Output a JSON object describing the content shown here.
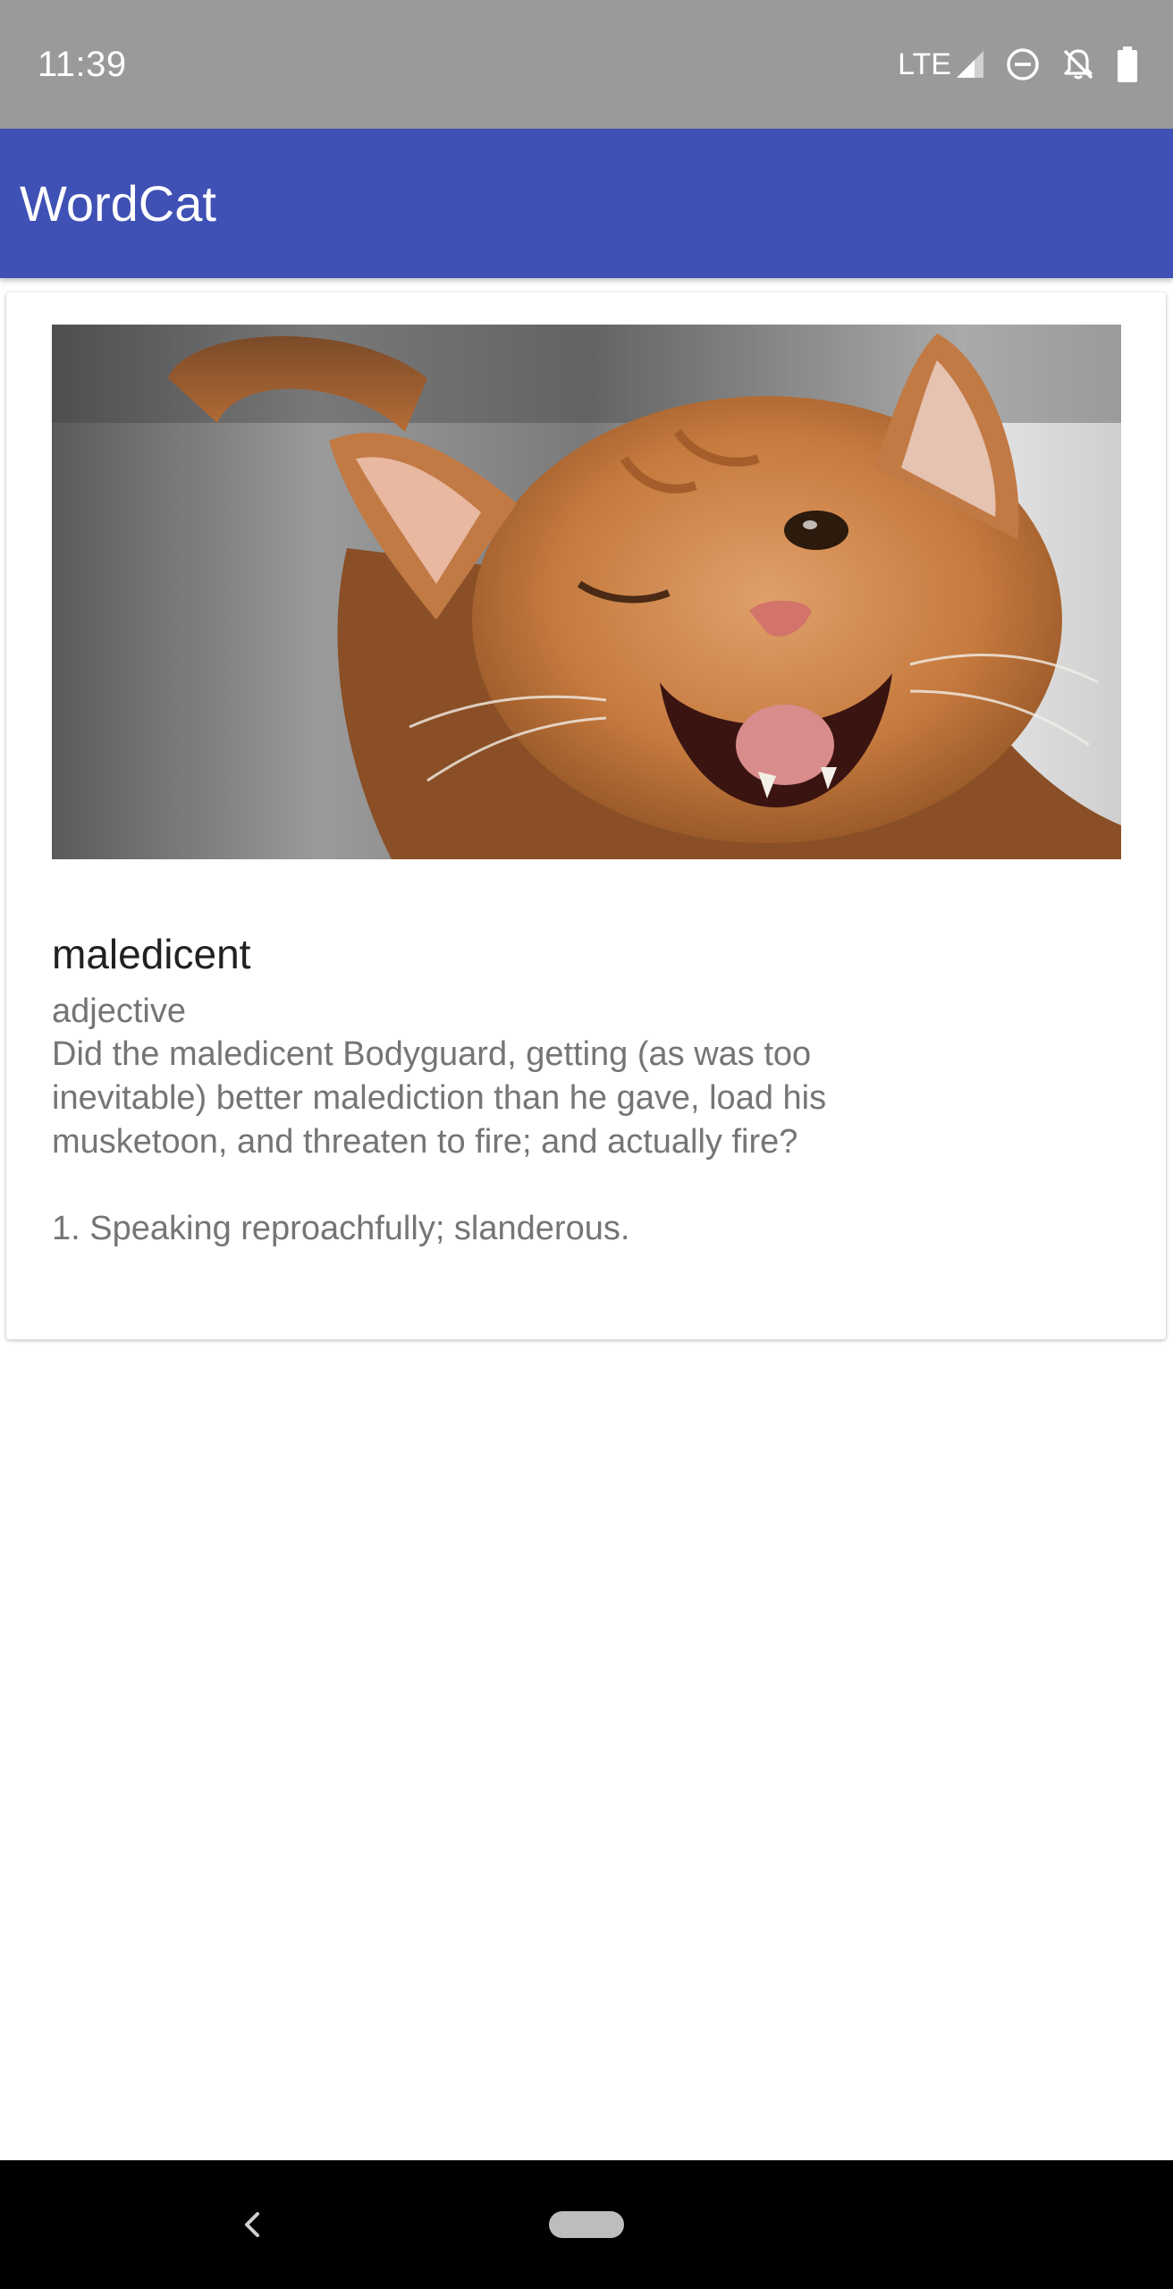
{
  "status_bar": {
    "time": "11:39",
    "network": "LTE",
    "icons": [
      "lte-signal-icon",
      "do-not-disturb-icon",
      "notifications-off-icon",
      "battery-icon"
    ]
  },
  "app_bar": {
    "title": "WordCat"
  },
  "card": {
    "image": {
      "alt": "cat-photo",
      "icon": "cat-image"
    },
    "word": "maledicent",
    "part_of_speech": "adjective",
    "example": "Did the maledicent Bodyguard, getting (as was too inevitable) better malediction than he gave, load his musketoon, and threaten to fire; and actually fire?",
    "definition": "1. Speaking reproachfully; slanderous."
  },
  "nav_bar": {
    "back_icon": "back-chevron-icon",
    "home_icon": "home-pill-icon"
  },
  "colors": {
    "status_bar": "#9a9a9a",
    "app_bar": "#3f51b5",
    "title_text": "#212121",
    "secondary_text": "#757575",
    "nav_bar": "#000000"
  }
}
